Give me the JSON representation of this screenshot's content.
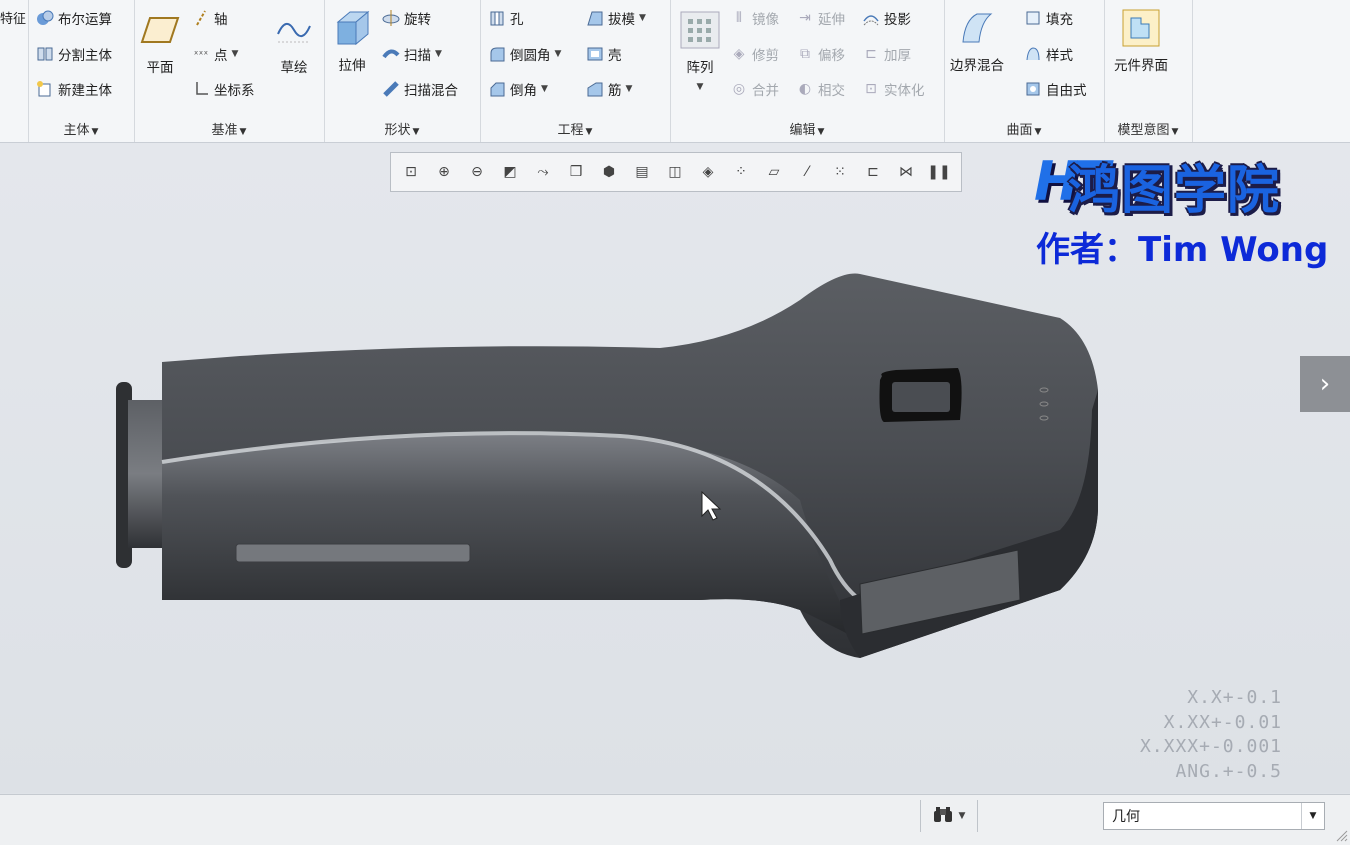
{
  "ribbon": {
    "partial_left": "特征",
    "groups": {
      "body": {
        "label": "主体",
        "items": [
          "布尔运算",
          "分割主体",
          "新建主体"
        ]
      },
      "datum": {
        "label": "基准",
        "plane": "平面",
        "axis": "轴",
        "point": "点",
        "csys": "坐标系",
        "sketch": "草绘"
      },
      "shapes": {
        "label": "形状",
        "extrude": "拉伸",
        "revolve": "旋转",
        "sweep": "扫描",
        "swept_blend": "扫描混合"
      },
      "engineering": {
        "label": "工程",
        "hole": "孔",
        "round": "倒圆角",
        "chamfer": "倒角",
        "draft": "拔模",
        "shell": "壳",
        "rib": "筋"
      },
      "editing": {
        "label": "编辑",
        "pattern": "阵列",
        "mirror": "镜像",
        "extend": "延伸",
        "project": "投影",
        "trim": "修剪",
        "offset": "偏移",
        "thicken": "加厚",
        "merge": "合并",
        "intersect": "相交",
        "solidify": "实体化"
      },
      "surfaces": {
        "label": "曲面",
        "boundary_blend": "边界混合",
        "fill": "填充",
        "style": "样式",
        "freestyle": "自由式"
      },
      "model_intent": {
        "label": "模型意图",
        "component_interface": "元件界面"
      }
    }
  },
  "watermark": {
    "brand_mark": "HT",
    "brand": "鸿图学院",
    "author": "作者：Tim Wong"
  },
  "tolerances": [
    "X.X+-0.1",
    "X.XX+-0.01",
    "X.XXX+-0.001",
    "ANG.+-0.5"
  ],
  "statusbar": {
    "filter_value": "几何"
  },
  "colors": {
    "ribbon_bg": "#f4f6f8",
    "viewport_bg": "#dfe3e8",
    "model": "#4a4d52",
    "brand_blue": "#1a63e0",
    "author_blue": "#0d2ad8"
  }
}
